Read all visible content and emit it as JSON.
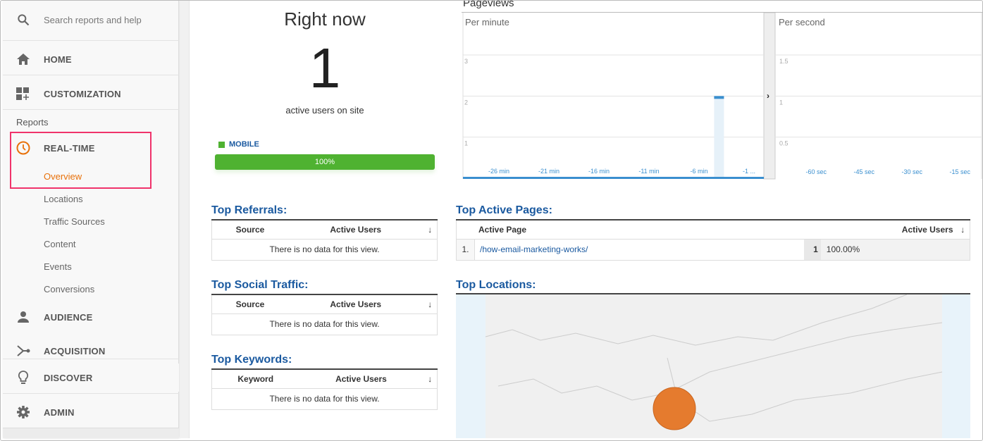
{
  "sidebar": {
    "search_placeholder": "Search reports and help",
    "home": "HOME",
    "customization": "CUSTOMIZATION",
    "reports_label": "Reports",
    "realtime": "REAL-TIME",
    "realtime_items": [
      "Overview",
      "Locations",
      "Traffic Sources",
      "Content",
      "Events",
      "Conversions"
    ],
    "audience": "AUDIENCE",
    "acquisition": "ACQUISITION",
    "discover": "DISCOVER",
    "admin": "ADMIN",
    "active_color": "#e8710a"
  },
  "right_now": {
    "title": "Right now",
    "count": "1",
    "subtitle": "active users on site",
    "segment_label": "MOBILE",
    "segment_percent": 100,
    "segment_percent_label": "100%",
    "segment_color": "#4fb231"
  },
  "chart_data": [
    {
      "type": "bar",
      "title": "Pageviews",
      "subtitle": "Per minute",
      "ylim": [
        0,
        3
      ],
      "yticks": [
        "1",
        "2",
        "3"
      ],
      "xtick_labels": [
        "-26 min",
        "-21 min",
        "-16 min",
        "-11 min",
        "-6 min",
        "-1 ..."
      ],
      "xtick_minutes": [
        -26,
        -21,
        -16,
        -11,
        -6,
        -1
      ],
      "bars": [
        {
          "minute": -4,
          "value": 2
        }
      ]
    },
    {
      "type": "bar",
      "subtitle": "Per second",
      "ylim": [
        0,
        1.5
      ],
      "yticks": [
        "0.5",
        "1",
        "1.5"
      ],
      "xtick_labels": [
        "-60 sec",
        "-45 sec",
        "-30 sec",
        "-15 sec"
      ],
      "bars": []
    }
  ],
  "top_referrals": {
    "title": "Top Referrals:",
    "columns": [
      "Source",
      "Active Users"
    ],
    "empty": "There is no data for this view."
  },
  "top_social": {
    "title": "Top Social Traffic:",
    "columns": [
      "Source",
      "Active Users"
    ],
    "empty": "There is no data for this view."
  },
  "top_keywords": {
    "title": "Top Keywords:",
    "columns": [
      "Keyword",
      "Active Users"
    ],
    "empty": "There is no data for this view."
  },
  "top_pages": {
    "title": "Top Active Pages:",
    "columns": [
      "Active Page",
      "Active Users"
    ],
    "rows": [
      {
        "rank": "1.",
        "page": "/how-email-marketing-works/",
        "users": "1",
        "percent": "100.00%"
      }
    ]
  },
  "top_locations": {
    "title": "Top Locations:",
    "marker_color": "#e57b2e"
  }
}
